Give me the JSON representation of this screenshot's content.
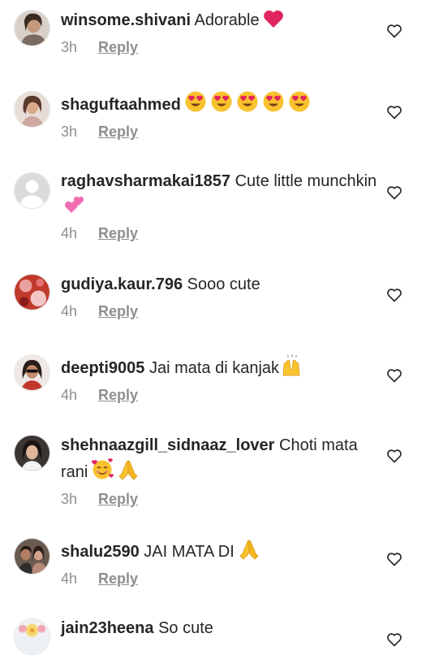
{
  "comments": [
    {
      "username": "winsome.shivani",
      "text": "Adorable",
      "time": "3h",
      "reply_label": "Reply",
      "emojis": [
        "red-heart"
      ],
      "avatar": "profile-photo"
    },
    {
      "username": "shaguftaahmed",
      "text": "",
      "time": "3h",
      "reply_label": "Reply",
      "emojis": [
        "heart-eyes",
        "heart-eyes",
        "heart-eyes",
        "heart-eyes",
        "heart-eyes"
      ],
      "avatar": "profile-photo"
    },
    {
      "username": "raghavsharmakai1857",
      "text": "Cute little munchkin",
      "time": "4h",
      "reply_label": "Reply",
      "emojis": [
        "two-hearts"
      ],
      "avatar": "default-avatar"
    },
    {
      "username": "gudiya.kaur.796",
      "text": "Sooo cute",
      "time": "4h",
      "reply_label": "Reply",
      "emojis": [],
      "avatar": "profile-photo"
    },
    {
      "username": "deepti9005",
      "text": "Jai mata di kanjak",
      "time": "4h",
      "reply_label": "Reply",
      "emojis": [
        "raising-hands"
      ],
      "avatar": "profile-photo"
    },
    {
      "username": "shehnaazgill_sidnaaz_lover",
      "text": "Choti mata rani",
      "time": "3h",
      "reply_label": "Reply",
      "emojis": [
        "smiling-hearts",
        "folded-hands"
      ],
      "avatar": "profile-photo"
    },
    {
      "username": "shalu2590",
      "text": "JAI MATA DI",
      "time": "4h",
      "reply_label": "Reply",
      "emojis": [
        "folded-hands"
      ],
      "avatar": "profile-photo"
    },
    {
      "username": "jain23heena",
      "text": "So cute",
      "time": "",
      "reply_label": "",
      "emojis": [],
      "avatar": "profile-photo"
    }
  ],
  "colors": {
    "text": "#262626",
    "meta": "#8e8e8e",
    "background": "#ffffff"
  }
}
